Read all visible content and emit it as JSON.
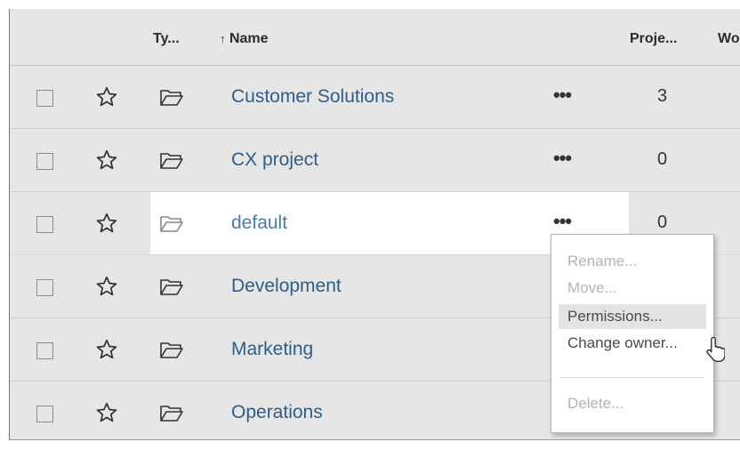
{
  "table": {
    "headers": {
      "type": "Ty...",
      "sort_arrow": "↑",
      "name": "Name",
      "project": "Proje...",
      "workbooks": "Wo"
    },
    "rows": [
      {
        "name": "Customer Solutions",
        "more": "•••",
        "count": "3"
      },
      {
        "name": "CX project",
        "more": "•••",
        "count": "0"
      },
      {
        "name": "default",
        "more": "•••",
        "count": "0"
      },
      {
        "name": "Development"
      },
      {
        "name": "Marketing"
      },
      {
        "name": "Operations"
      }
    ],
    "selected_row_index": 2
  },
  "context_menu": {
    "items": [
      {
        "label": "Rename...",
        "enabled": false
      },
      {
        "label": "Move...",
        "enabled": false
      },
      {
        "label": "Permissions...",
        "enabled": true,
        "hovered": true
      },
      {
        "label": "Change owner...",
        "enabled": true
      },
      {
        "label": "Delete...",
        "enabled": false
      }
    ]
  },
  "colors": {
    "background": "#e6e6e6",
    "selected_row": "#ffffff",
    "link": "#2f5d88",
    "disabled_text": "#b4b4b4"
  }
}
